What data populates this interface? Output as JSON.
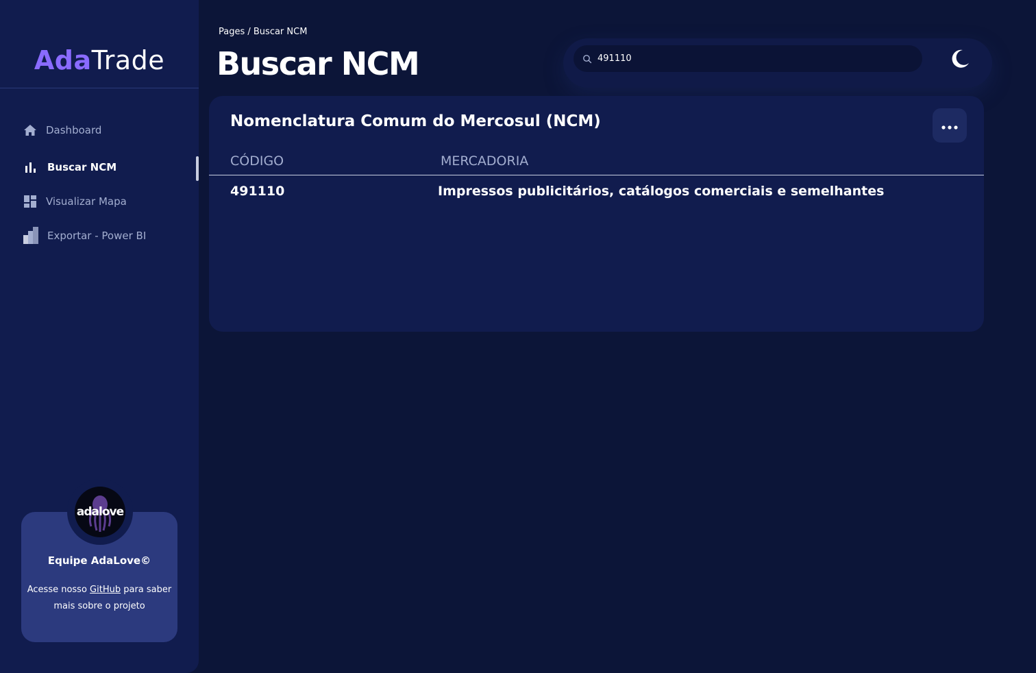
{
  "brand": {
    "part1": "Ada",
    "part2": "Trade",
    "accent": "#8a6bff"
  },
  "sidebar": {
    "items": [
      {
        "label": "Dashboard",
        "icon": "home-icon"
      },
      {
        "label": "Buscar NCM",
        "icon": "bar-chart-icon",
        "active": true
      },
      {
        "label": "Visualizar Mapa",
        "icon": "dashboard-grid-icon"
      },
      {
        "label": "Exportar - Power BI",
        "icon": "power-bi-icon"
      }
    ]
  },
  "promo": {
    "logo_text": "adalove",
    "title": "Equipe AdaLove©",
    "text_before": "Acesse nosso ",
    "link": "GitHub",
    "text_after": " para saber mais sobre o projeto"
  },
  "header": {
    "breadcrumb": "Pages / Buscar NCM",
    "title": "Buscar NCM"
  },
  "search": {
    "value": "491110",
    "icon": "search-icon"
  },
  "theme_toggle": {
    "icon": "moon-icon"
  },
  "card": {
    "title": "Nomenclatura Comum do Mercosul (NCM)",
    "menu_icon": "more-horizontal-icon",
    "columns": [
      "CÓDIGO",
      "MERCADORIA"
    ],
    "rows": [
      {
        "code": "491110",
        "description": "Impressos publicitários, catálogos comerciais e semelhantes"
      }
    ]
  },
  "colors": {
    "background": "#0c1538",
    "panel": "#111c4e",
    "promo_card": "#2c3a7e",
    "muted_text": "#a3aed0"
  }
}
